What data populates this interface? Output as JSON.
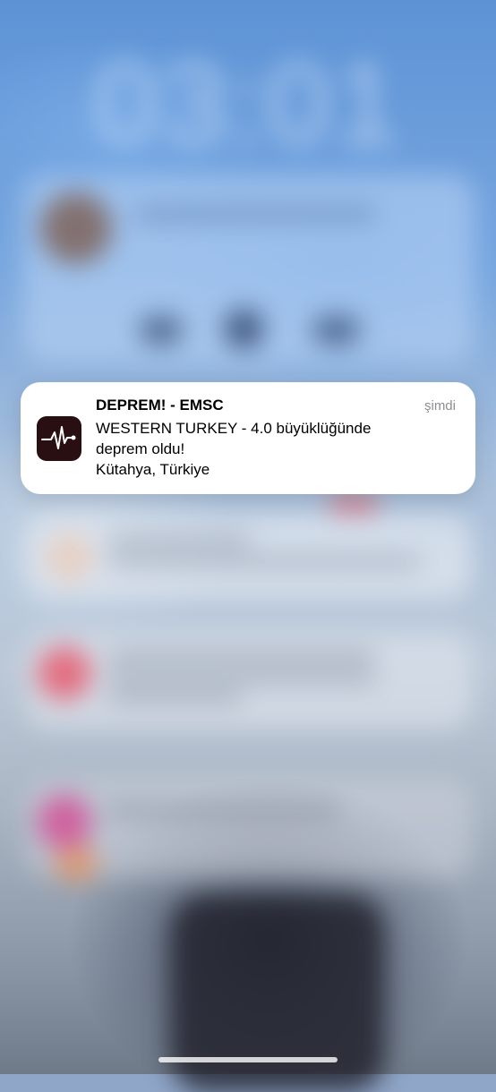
{
  "notification": {
    "app_name": "DEPREM! - EMSC",
    "time": "şimdi",
    "message": "WESTERN TURKEY - 4.0 büyüklüğünde\ndeprem oldu!\nKütahya, Türkiye",
    "icon": "seismograph-icon"
  }
}
